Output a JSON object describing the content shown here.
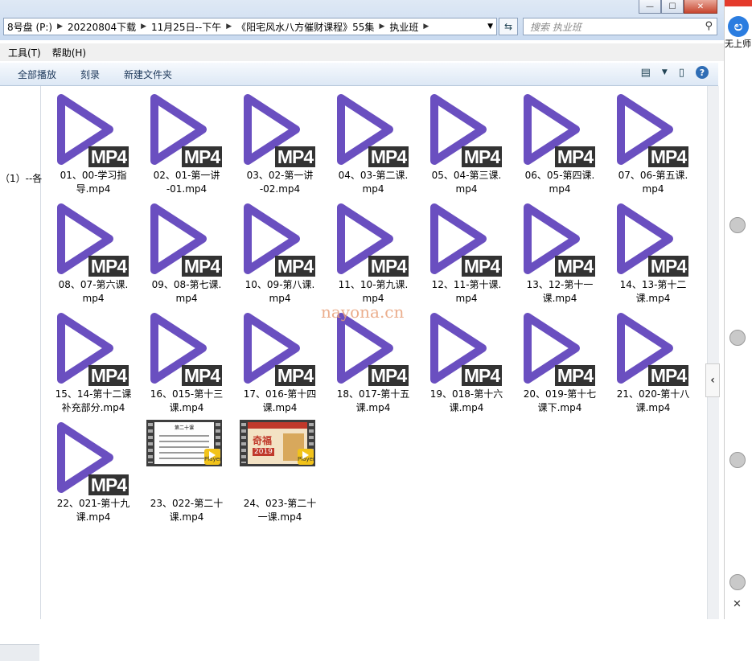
{
  "window": {
    "minimize": "—",
    "maximize": "☐",
    "close": "✕"
  },
  "address": {
    "crumbs": [
      "8号盘 (P:)",
      "20220804下载",
      "11月25日--下午",
      "《阳宅风水八方催财课程》55集",
      "执业班"
    ],
    "sep": "▶",
    "drop": "▼"
  },
  "refresh_glyph": "⇆",
  "search": {
    "placeholder": "搜索 执业班",
    "icon": "⚲"
  },
  "menu": [
    "工具(T)",
    "帮助(H)"
  ],
  "toolbar": {
    "buttons": [
      "全部播放",
      "刻录",
      "新建文件夹"
    ],
    "view_icon": "▤",
    "view_drop": "▼",
    "pane_icon": "▯",
    "help": "?"
  },
  "nav": {
    "text": "（1）--各"
  },
  "files": [
    {
      "line1": "01、00-学习指",
      "line2": "导.mp4",
      "kind": "mp4"
    },
    {
      "line1": "02、01-第一讲",
      "line2": "-01.mp4",
      "kind": "mp4"
    },
    {
      "line1": "03、02-第一讲",
      "line2": "-02.mp4",
      "kind": "mp4"
    },
    {
      "line1": "04、03-第二课.",
      "line2": "mp4",
      "kind": "mp4"
    },
    {
      "line1": "05、04-第三课.",
      "line2": "mp4",
      "kind": "mp4"
    },
    {
      "line1": "06、05-第四课.",
      "line2": "mp4",
      "kind": "mp4"
    },
    {
      "line1": "07、06-第五课.",
      "line2": "mp4",
      "kind": "mp4"
    },
    {
      "line1": "08、07-第六课.",
      "line2": "mp4",
      "kind": "mp4"
    },
    {
      "line1": "09、08-第七课.",
      "line2": "mp4",
      "kind": "mp4"
    },
    {
      "line1": "10、09-第八课.",
      "line2": "mp4",
      "kind": "mp4"
    },
    {
      "line1": "11、10-第九课.",
      "line2": "mp4",
      "kind": "mp4"
    },
    {
      "line1": "12、11-第十课.",
      "line2": "mp4",
      "kind": "mp4"
    },
    {
      "line1": "13、12-第十一",
      "line2": "课.mp4",
      "kind": "mp4"
    },
    {
      "line1": "14、13-第十二",
      "line2": "课.mp4",
      "kind": "mp4"
    },
    {
      "line1": "15、14-第十二课",
      "line2": "补充部分.mp4",
      "kind": "mp4"
    },
    {
      "line1": "16、015-第十三",
      "line2": "课.mp4",
      "kind": "mp4"
    },
    {
      "line1": "17、016-第十四",
      "line2": "课.mp4",
      "kind": "mp4"
    },
    {
      "line1": "18、017-第十五",
      "line2": "课.mp4",
      "kind": "mp4"
    },
    {
      "line1": "19、018-第十六",
      "line2": "课.mp4",
      "kind": "mp4"
    },
    {
      "line1": "20、019-第十七",
      "line2": "课下.mp4",
      "kind": "mp4"
    },
    {
      "line1": "21、020-第十八",
      "line2": "课.mp4",
      "kind": "mp4"
    },
    {
      "line1": "22、021-第十九",
      "line2": "课.mp4",
      "kind": "mp4"
    },
    {
      "line1": "23、022-第二十",
      "line2": "课.mp4",
      "kind": "thumb-slides"
    },
    {
      "line1": "24、023-第二十",
      "line2": "一课.mp4",
      "kind": "thumb-poster"
    }
  ],
  "badge_text": "MP4",
  "player_badge": "Player",
  "poster": {
    "year": "2019",
    "big": "奇福"
  },
  "slides_title": "第二十课",
  "watermark": "nayona.cn",
  "side": {
    "label": "无上师",
    "logo": "ಲ",
    "close": "✕"
  },
  "colors": {
    "play": "#6a4fc0",
    "badge_bg": "#333333"
  }
}
